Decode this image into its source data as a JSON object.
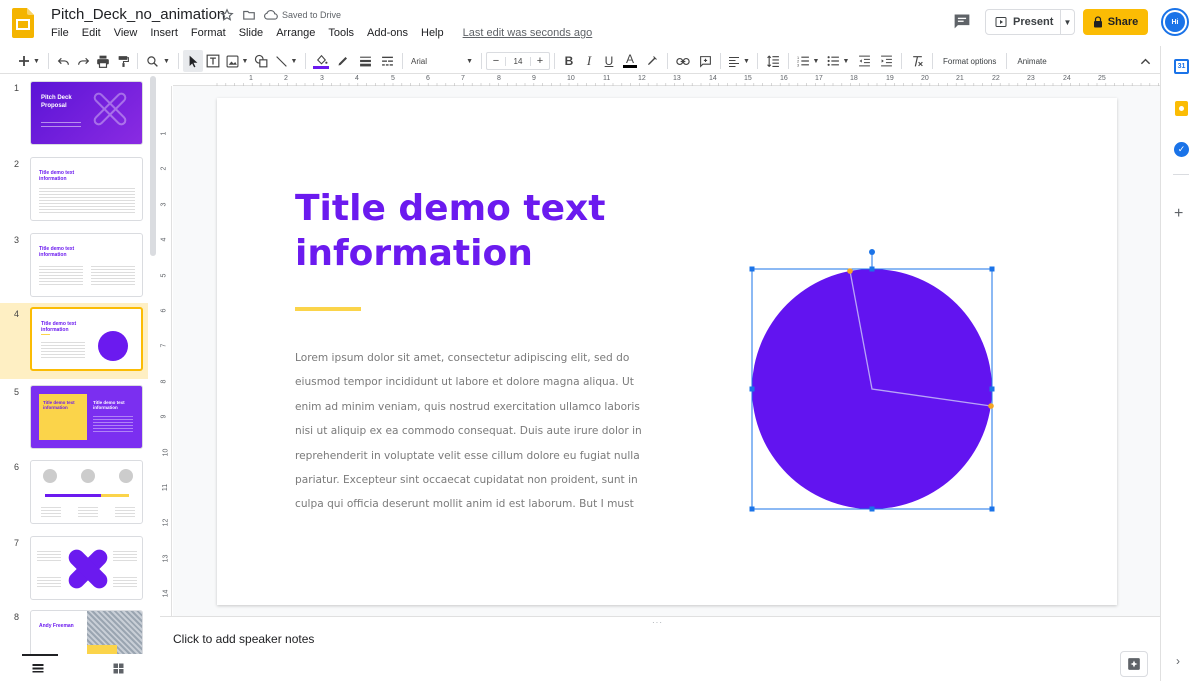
{
  "doc": {
    "title": "Pitch_Deck_no_animation",
    "saved_status": "Saved to Drive",
    "last_edit": "Last edit was seconds ago"
  },
  "menu": [
    "File",
    "Edit",
    "View",
    "Insert",
    "Format",
    "Slide",
    "Arrange",
    "Tools",
    "Add-ons",
    "Help"
  ],
  "header": {
    "present_label": "Present",
    "share_label": "Share",
    "avatar_initials": "Hi"
  },
  "toolbar": {
    "font_name": "Arial",
    "font_size": "14",
    "format_options_label": "Format options",
    "animate_label": "Animate"
  },
  "ruler": {
    "horizontal": [
      "1",
      "1",
      "2",
      "3",
      "4",
      "5",
      "6",
      "7",
      "8",
      "9",
      "10",
      "11",
      "12",
      "13",
      "14",
      "15",
      "16",
      "17",
      "18",
      "19",
      "20",
      "21",
      "22",
      "23",
      "24",
      "25"
    ],
    "vertical": [
      "1",
      "2",
      "3",
      "4",
      "5",
      "6",
      "7",
      "8",
      "9",
      "10",
      "11",
      "12",
      "13",
      "14"
    ]
  },
  "slides": [
    {
      "number": "1",
      "title": "Pitch Deck Proposal"
    },
    {
      "number": "2",
      "title": "Title demo text information"
    },
    {
      "number": "3",
      "title": "Title demo text information"
    },
    {
      "number": "4",
      "title": "Title demo text information",
      "selected": true
    },
    {
      "number": "5",
      "title": "Title demo text information"
    },
    {
      "number": "6",
      "title": ""
    },
    {
      "number": "7",
      "title": ""
    },
    {
      "number": "8",
      "title": "Andy Freeman"
    }
  ],
  "slide": {
    "title": "Title demo text information",
    "body": "Lorem ipsum dolor sit amet, consectetur adipiscing elit, sed do eiusmod tempor incididunt ut labore et dolore magna aliqua. Ut enim ad minim veniam, quis nostrud exercitation ullamco laboris nisi ut aliquip ex ea commodo consequat. Duis aute irure dolor in reprehenderit in voluptate velit esse cillum dolore eu fugiat nulla pariatur. Excepteur sint occaecat cupidatat non proident, sunt in culpa qui officia deserunt mollit anim id est laborum. But I must"
  },
  "notes": {
    "placeholder": "Click to add speaker notes"
  },
  "colors": {
    "accent_purple": "#6b1aef",
    "share_yellow": "#fbbc04",
    "rule_yellow": "#fbd44a",
    "selection_blue": "#1a73e8"
  }
}
